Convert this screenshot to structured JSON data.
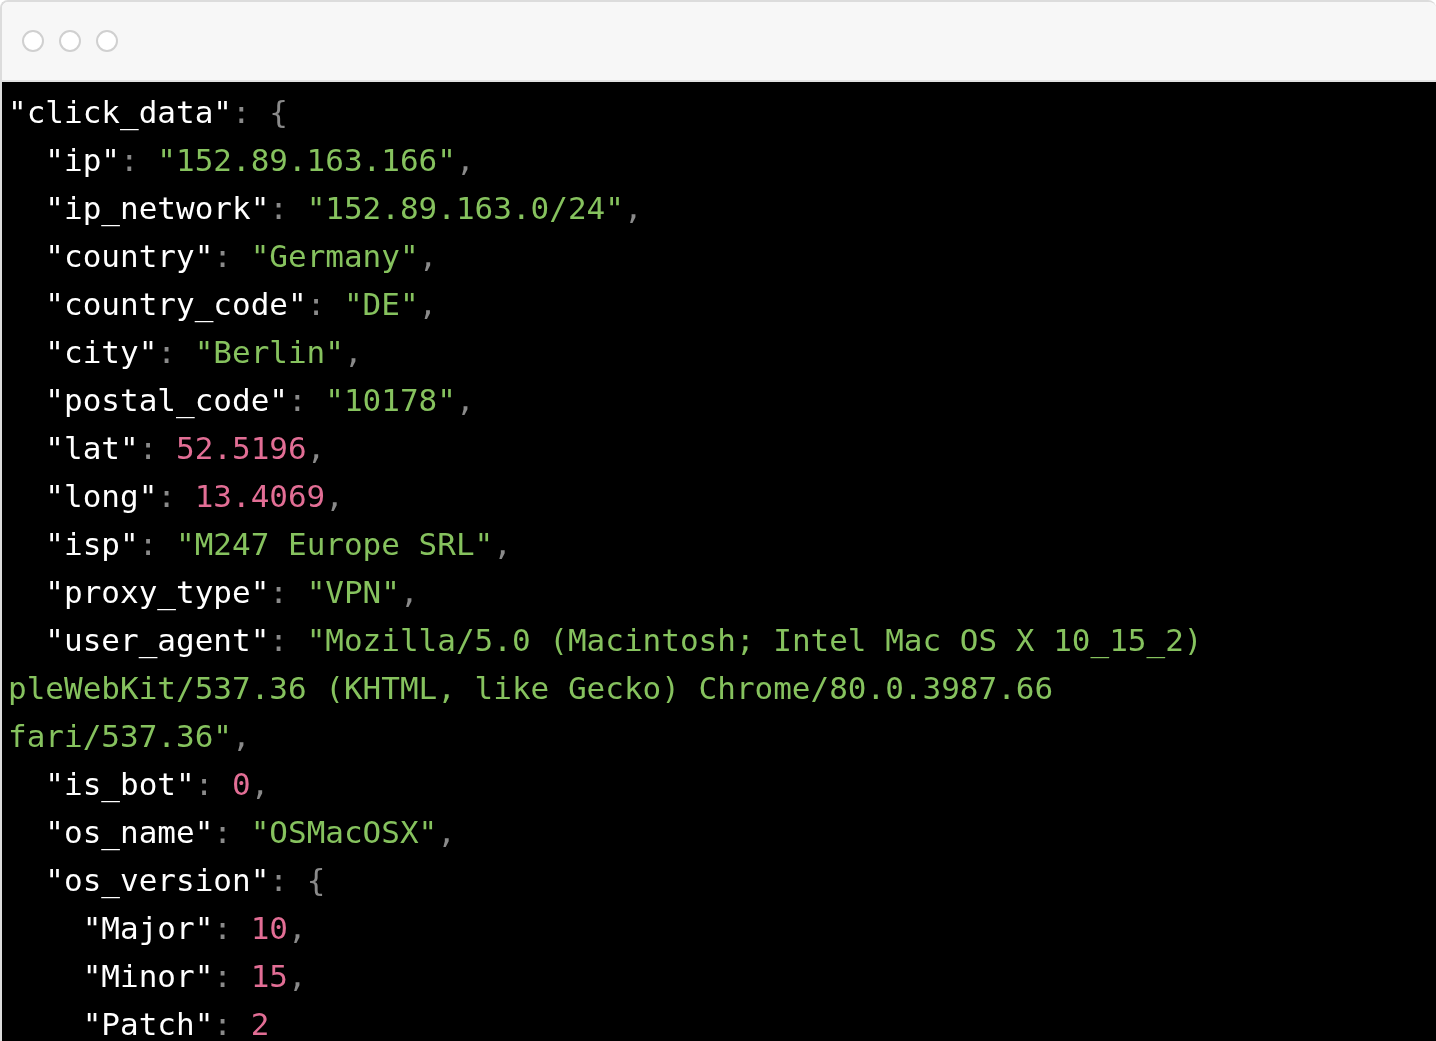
{
  "window": {
    "controls": [
      {
        "kind": "circle"
      },
      {
        "kind": "circle"
      },
      {
        "kind": "circle"
      }
    ]
  },
  "code_lines": [
    {
      "tokens": [
        {
          "kind": "key",
          "text": "\"click_data\""
        },
        {
          "kind": "punct",
          "text": ": "
        },
        {
          "kind": "brace",
          "text": "{"
        }
      ]
    },
    {
      "tokens": [
        {
          "kind": "key",
          "text": "  \"ip\""
        },
        {
          "kind": "punct",
          "text": ": "
        },
        {
          "kind": "string",
          "text": "\"152.89.163.166\""
        },
        {
          "kind": "punct",
          "text": ","
        }
      ]
    },
    {
      "tokens": [
        {
          "kind": "key",
          "text": "  \"ip_network\""
        },
        {
          "kind": "punct",
          "text": ": "
        },
        {
          "kind": "string",
          "text": "\"152.89.163.0/24\""
        },
        {
          "kind": "punct",
          "text": ","
        }
      ]
    },
    {
      "tokens": [
        {
          "kind": "key",
          "text": "  \"country\""
        },
        {
          "kind": "punct",
          "text": ": "
        },
        {
          "kind": "string",
          "text": "\"Germany\""
        },
        {
          "kind": "punct",
          "text": ","
        }
      ]
    },
    {
      "tokens": [
        {
          "kind": "key",
          "text": "  \"country_code\""
        },
        {
          "kind": "punct",
          "text": ": "
        },
        {
          "kind": "string",
          "text": "\"DE\""
        },
        {
          "kind": "punct",
          "text": ","
        }
      ]
    },
    {
      "tokens": [
        {
          "kind": "key",
          "text": "  \"city\""
        },
        {
          "kind": "punct",
          "text": ": "
        },
        {
          "kind": "string",
          "text": "\"Berlin\""
        },
        {
          "kind": "punct",
          "text": ","
        }
      ]
    },
    {
      "tokens": [
        {
          "kind": "key",
          "text": "  \"postal_code\""
        },
        {
          "kind": "punct",
          "text": ": "
        },
        {
          "kind": "string",
          "text": "\"10178\""
        },
        {
          "kind": "punct",
          "text": ","
        }
      ]
    },
    {
      "tokens": [
        {
          "kind": "key",
          "text": "  \"lat\""
        },
        {
          "kind": "punct",
          "text": ": "
        },
        {
          "kind": "number",
          "text": "52.5196"
        },
        {
          "kind": "punct",
          "text": ","
        }
      ]
    },
    {
      "tokens": [
        {
          "kind": "key",
          "text": "  \"long\""
        },
        {
          "kind": "punct",
          "text": ": "
        },
        {
          "kind": "number",
          "text": "13.4069"
        },
        {
          "kind": "punct",
          "text": ","
        }
      ]
    },
    {
      "tokens": [
        {
          "kind": "key",
          "text": "  \"isp\""
        },
        {
          "kind": "punct",
          "text": ": "
        },
        {
          "kind": "string",
          "text": "\"M247 Europe SRL\""
        },
        {
          "kind": "punct",
          "text": ","
        }
      ]
    },
    {
      "tokens": [
        {
          "kind": "key",
          "text": "  \"proxy_type\""
        },
        {
          "kind": "punct",
          "text": ": "
        },
        {
          "kind": "string",
          "text": "\"VPN\""
        },
        {
          "kind": "punct",
          "text": ","
        }
      ]
    },
    {
      "tokens": [
        {
          "kind": "key",
          "text": "  \"user_agent\""
        },
        {
          "kind": "punct",
          "text": ": "
        },
        {
          "kind": "string",
          "text": "\"Mozilla/5.0 (Macintosh; Intel Mac OS X 10_15_2)"
        }
      ]
    },
    {
      "tokens": [
        {
          "kind": "string",
          "text": "pleWebKit/537.36 (KHTML, like Gecko) Chrome/80.0.3987.66"
        }
      ]
    },
    {
      "tokens": [
        {
          "kind": "string",
          "text": "fari/537.36\""
        },
        {
          "kind": "punct",
          "text": ","
        }
      ]
    },
    {
      "tokens": [
        {
          "kind": "key",
          "text": "  \"is_bot\""
        },
        {
          "kind": "punct",
          "text": ": "
        },
        {
          "kind": "number",
          "text": "0"
        },
        {
          "kind": "punct",
          "text": ","
        }
      ]
    },
    {
      "tokens": [
        {
          "kind": "key",
          "text": "  \"os_name\""
        },
        {
          "kind": "punct",
          "text": ": "
        },
        {
          "kind": "string",
          "text": "\"OSMacOSX\""
        },
        {
          "kind": "punct",
          "text": ","
        }
      ]
    },
    {
      "tokens": [
        {
          "kind": "key",
          "text": "  \"os_version\""
        },
        {
          "kind": "punct",
          "text": ": "
        },
        {
          "kind": "brace",
          "text": "{"
        }
      ]
    },
    {
      "tokens": [
        {
          "kind": "key",
          "text": "    \"Major\""
        },
        {
          "kind": "punct",
          "text": ": "
        },
        {
          "kind": "number",
          "text": "10"
        },
        {
          "kind": "punct",
          "text": ","
        }
      ]
    },
    {
      "tokens": [
        {
          "kind": "key",
          "text": "    \"Minor\""
        },
        {
          "kind": "punct",
          "text": ": "
        },
        {
          "kind": "number",
          "text": "15"
        },
        {
          "kind": "punct",
          "text": ","
        }
      ]
    },
    {
      "tokens": [
        {
          "kind": "key",
          "text": "    \"Patch\""
        },
        {
          "kind": "punct",
          "text": ": "
        },
        {
          "kind": "number",
          "text": "2"
        }
      ]
    }
  ]
}
